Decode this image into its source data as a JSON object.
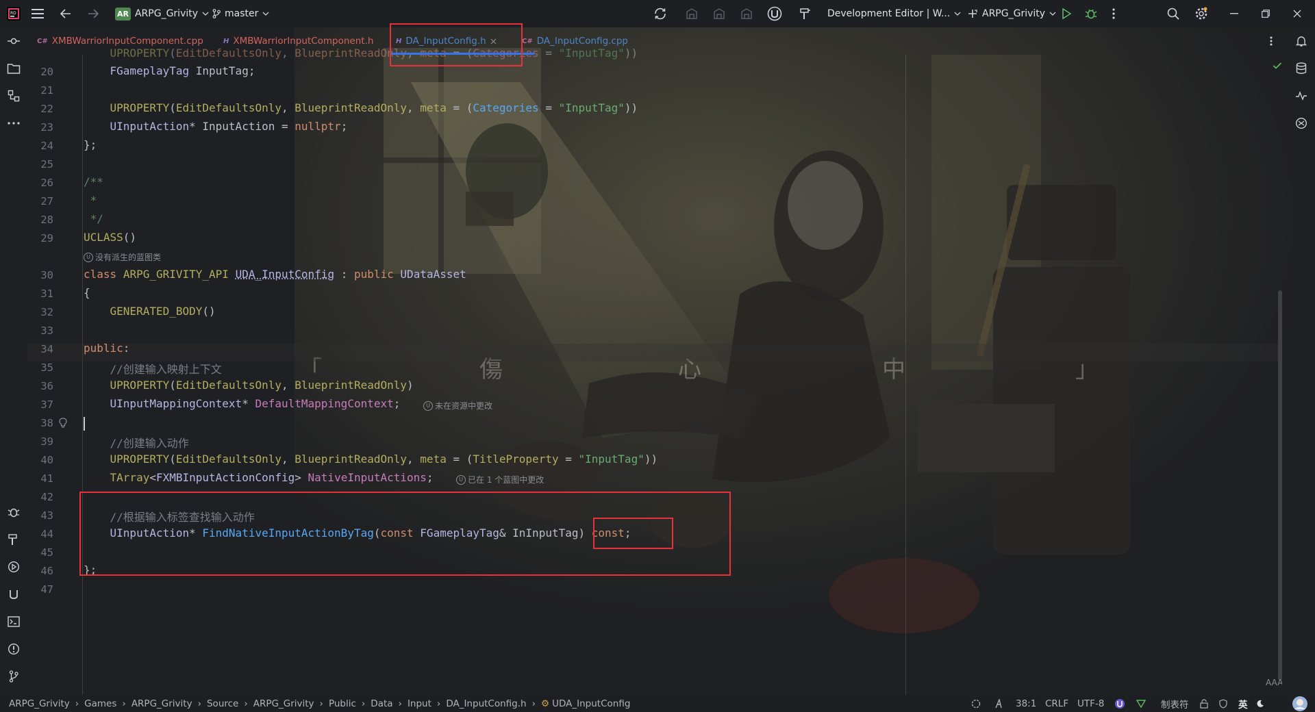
{
  "titlebar": {
    "app_badge": "AR",
    "project": "ARPG_Grivity",
    "branch": "master",
    "run_config": "Development Editor | W...",
    "target": "ARPG_Grivity"
  },
  "tabs": [
    {
      "label": "XMBWarriorInputComponent.cpp",
      "kind": "cpp"
    },
    {
      "label": "XMBWarriorInputComponent.h",
      "kind": "h"
    },
    {
      "label": "DA_InputConfig.h",
      "kind": "h",
      "active": true
    },
    {
      "label": "DA_InputConfig.cpp",
      "kind": "cpp"
    }
  ],
  "hints": {
    "no_derived": "没有派生的蓝图类",
    "not_changed": "未在资源中更改",
    "changed_in_one": "已在 1 个蓝图中更改"
  },
  "watermark": [
    "「",
    "傷",
    "心",
    "中",
    "」"
  ],
  "breadcrumb": [
    "ARPG_Grivity",
    "Games",
    "ARPG_Grivity",
    "Source",
    "ARPG_Grivity",
    "Public",
    "Data",
    "Input",
    "DA_InputConfig.h",
    "UDA_InputConfig"
  ],
  "status": {
    "position": "38:1",
    "line_ending": "CRLF",
    "encoding": "UTF-8",
    "indent": "制表符",
    "ime": "英"
  },
  "colors": {
    "highlight": "#e8313a",
    "keyword": "#cf8e6d",
    "macro": "#b3ae60",
    "string": "#6aab73",
    "function": "#56a8f5"
  }
}
